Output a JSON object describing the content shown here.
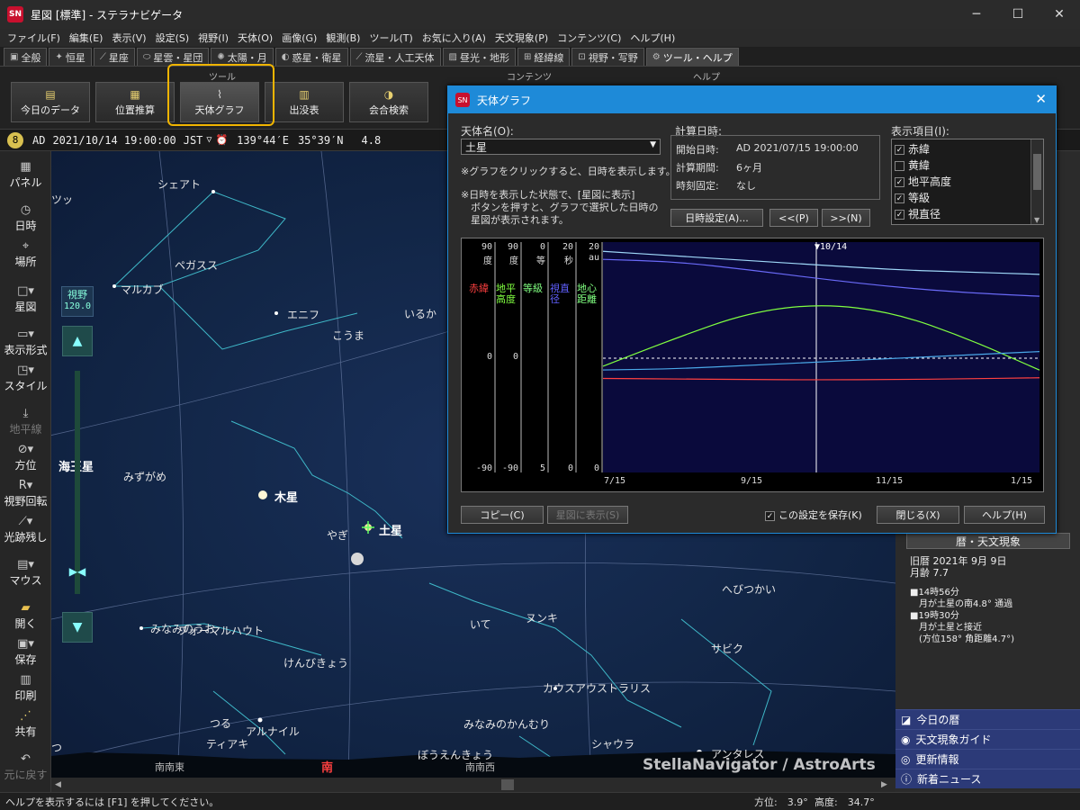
{
  "window": {
    "title": "星図 [標準] - ステラナビゲータ",
    "icon": "SN"
  },
  "menu": [
    "ファイル(F)",
    "編集(E)",
    "表示(V)",
    "設定(S)",
    "視野(I)",
    "天体(O)",
    "画像(G)",
    "観測(B)",
    "ツール(T)",
    "お気に入り(A)",
    "天文現象(P)",
    "コンテンツ(C)",
    "ヘルプ(H)"
  ],
  "tabs": [
    {
      "label": "全般",
      "icon": "square-icon"
    },
    {
      "label": "恒星",
      "icon": "star-icon"
    },
    {
      "label": "星座",
      "icon": "constellation-icon"
    },
    {
      "label": "星雲・星団",
      "icon": "nebula-icon"
    },
    {
      "label": "太陽・月",
      "icon": "sun-icon"
    },
    {
      "label": "惑星・衛星",
      "icon": "planet-icon"
    },
    {
      "label": "流星・人工天体",
      "icon": "meteor-icon"
    },
    {
      "label": "昼光・地形",
      "icon": "landscape-icon"
    },
    {
      "label": "経緯線",
      "icon": "grid-icon"
    },
    {
      "label": "視野・写野",
      "icon": "camera-icon"
    },
    {
      "label": "ツール・ヘルプ",
      "icon": "gear-icon"
    }
  ],
  "ribbon": {
    "groups": [
      "ツール",
      "コンテンツ",
      "ヘルプ"
    ],
    "buttons": [
      "今日のデータ",
      "位置推算",
      "天体グラフ",
      "出没表",
      "会合検索"
    ]
  },
  "status_line": {
    "era": "AD",
    "datetime": "2021/10/14 19:00:00",
    "tz": "JST",
    "lon": "139°44′E",
    "lat": "35°39′N",
    "extra": "4.8"
  },
  "sidebar": [
    {
      "label": "パネル",
      "icon": "panel-icon"
    },
    {
      "label": "日時",
      "icon": "clock-icon"
    },
    {
      "label": "場所",
      "icon": "location-icon"
    },
    {
      "label": "星図",
      "icon": "chart-icon"
    },
    {
      "label": "表示形式",
      "icon": "display-icon"
    },
    {
      "label": "スタイル",
      "icon": "style-icon"
    },
    {
      "label": "地平線",
      "icon": "horizon-icon",
      "disabled": true
    },
    {
      "label": "方位",
      "icon": "compass-icon"
    },
    {
      "label": "視野回転",
      "icon": "rotate-icon"
    },
    {
      "label": "光跡残し",
      "icon": "trail-icon"
    },
    {
      "label": "マウス",
      "icon": "mouse-icon"
    },
    {
      "label": "開く",
      "icon": "open-icon"
    },
    {
      "label": "保存",
      "icon": "save-icon"
    },
    {
      "label": "印刷",
      "icon": "print-icon"
    },
    {
      "label": "共有",
      "icon": "share-icon"
    },
    {
      "label": "元に戻す",
      "icon": "undo-icon",
      "disabled": true
    }
  ],
  "fov": {
    "label": "視野",
    "value": "120.0"
  },
  "starmap": {
    "constellations": [
      "ツッ",
      "シェアト",
      "ペガスス",
      "マルカブ",
      "エニフ",
      "いるか",
      "こうま",
      "みずがめ",
      "やぎ",
      "みなみのうお",
      "フォーマルハウト",
      "けんびきょう",
      "いて",
      "ヌンキ",
      "サビク",
      "へびつかい",
      "カウスアウストラリス",
      "みなみのかんむり",
      "シャウラ",
      "アンタレス",
      "つる",
      "アルナイル",
      "ティアキ",
      "ぼうえんきょう",
      "つ",
      "海王星"
    ],
    "planets": {
      "jupiter": "木星",
      "saturn": "土星",
      "neptune": "海王星"
    },
    "horizon": {
      "se": "南南東",
      "s": "南",
      "ssw": "南南西"
    },
    "watermark": "StellaNavigator / AstroArts"
  },
  "dialog": {
    "title": "天体グラフ",
    "object_label": "天体名(O):",
    "object_value": "土星",
    "note1": "※グラフをクリックすると、日時を表示します。",
    "note2": "※日時を表示した状態で、[星図に表示]\n　ボタンを押すと、グラフで選択した日時の\n　星図が表示されます。",
    "calc": {
      "label": "計算日時:",
      "start_label": "開始日時:",
      "start": "AD 2021/07/15 19:00:00",
      "period_label": "計算期間:",
      "period": "6ヶ月",
      "fixed_label": "時刻固定:",
      "fixed": "なし"
    },
    "buttons": {
      "datetime": "日時設定(A)...",
      "prev": "<<(P)",
      "next": ">>(N)",
      "copy": "コピー(C)",
      "show": "星図に表示(S)",
      "close": "閉じる(X)",
      "help": "ヘルプ(H)"
    },
    "save_label": "この設定を保存(K)",
    "items_label": "表示項目(I):",
    "items": [
      {
        "label": "赤緯",
        "checked": true
      },
      {
        "label": "黄緯",
        "checked": false
      },
      {
        "label": "地平高度",
        "checked": true
      },
      {
        "label": "等級",
        "checked": true
      },
      {
        "label": "視直径",
        "checked": true
      }
    ]
  },
  "chart_data": {
    "type": "line",
    "x_ticks": [
      "7/15",
      "9/15",
      "11/15",
      "1/15"
    ],
    "marker": "▼10/14",
    "axes": [
      {
        "top": "90",
        "unit": "度",
        "name": "赤緯",
        "bottom": "-90",
        "mid": "0",
        "color": "#ff4040"
      },
      {
        "top": "90",
        "unit": "度",
        "name": "地平高度",
        "bottom": "-90",
        "mid": "0",
        "color": "#80ff40"
      },
      {
        "top": "0",
        "unit": "等",
        "name": "等級",
        "bottom": "5",
        "color": "#80ff80"
      },
      {
        "top": "20",
        "unit": "秒",
        "name": "視直径",
        "bottom": "0",
        "color": "#6060ff"
      },
      {
        "top": "20",
        "unit": "au",
        "name": "地心距離",
        "bottom": "0",
        "color": "#80ff80"
      }
    ],
    "series": [
      {
        "name": "赤緯",
        "color": "#ff4040",
        "points": [
          -16.5,
          -16.9,
          -17.4,
          -17.6,
          -17.4,
          -16.8,
          -16.0
        ]
      },
      {
        "name": "地平高度",
        "color": "#80ff40",
        "points": [
          -7,
          15,
          35,
          42,
          35,
          15,
          -10
        ]
      },
      {
        "name": "等級",
        "color": "#9fd8f8",
        "points": [
          0.2,
          0.3,
          0.4,
          0.5,
          0.6,
          0.65,
          0.7
        ]
      },
      {
        "name": "視直径",
        "color": "#6a6af8",
        "points": [
          18.5,
          18.3,
          17.6,
          16.8,
          16.1,
          15.6,
          15.3
        ]
      },
      {
        "name": "地心距離",
        "color": "#4aa8e8",
        "points": [
          8.9,
          9.0,
          9.3,
          9.6,
          9.9,
          10.2,
          10.5
        ]
      }
    ]
  },
  "right_panel": {
    "section": "暦・天文現象",
    "lunar": "旧暦 2021年 9月 9日",
    "moon_age": "月齢 7.7",
    "events": [
      "■14時56分\n　月が土星の南4.8° 通過",
      "■19時30分\n　月が土星と接近\n　(方位158° 角距離4.7°)"
    ],
    "groups": [
      "今日の暦",
      "天文現象ガイド",
      "更新情報",
      "新着ニュース"
    ]
  },
  "status": {
    "help": "ヘルプを表示するには [F1] を押してください。",
    "azimuth": "方位:　3.9°",
    "altitude": "高度:　34.7°"
  }
}
